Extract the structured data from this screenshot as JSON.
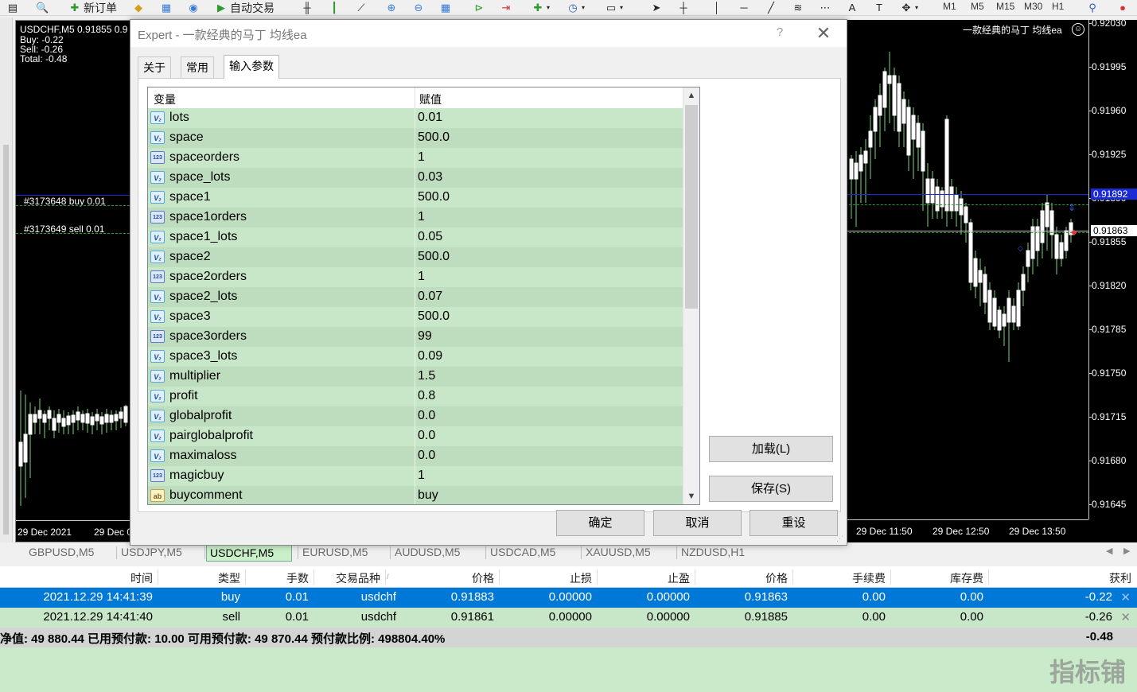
{
  "toolbar": {
    "new_order": "新订单",
    "auto_trading": "自动交易",
    "timeframes": [
      "M1",
      "M5",
      "M15",
      "M30",
      "H1"
    ]
  },
  "chart_left": {
    "symbol_label": "USDCHF,M5  0.91855 0.9",
    "buy": "Buy: -0.22",
    "sell": "Sell: -0.26",
    "total": "Total: -0.48",
    "order_buy": "#3173648 buy 0.01",
    "order_sell": "#3173649 sell 0.01",
    "date1": "29 Dec 2021",
    "date2": "29 Dec 0"
  },
  "chart_right": {
    "ea_label": "一款经典的马丁 均线ea",
    "smile_icon": "smile-icon",
    "prices": [
      "0.92030",
      "0.91995",
      "0.91960",
      "0.91925",
      "0.91890",
      "0.91855",
      "0.91820",
      "0.91785",
      "0.91750",
      "0.91715",
      "0.91680",
      "0.91645"
    ],
    "ask_price": "0.91892",
    "bid_price": "0.91863",
    "times": [
      "29 Dec 11:50",
      "29 Dec 12:50",
      "29 Dec 13:50"
    ]
  },
  "chart_tabs": [
    {
      "label": "GBPUSD,M5",
      "active": false
    },
    {
      "label": "USDJPY,M5",
      "active": false
    },
    {
      "label": "USDCHF,M5",
      "active": true
    },
    {
      "label": "EURUSD,M5",
      "active": false
    },
    {
      "label": "AUDUSD,M5",
      "active": false
    },
    {
      "label": "USDCAD,M5",
      "active": false
    },
    {
      "label": "XAUUSD,M5",
      "active": false
    },
    {
      "label": "NZDUSD,H1",
      "active": false
    }
  ],
  "terminal": {
    "columns": [
      "时间",
      "类型",
      "手数",
      "交易品种",
      "价格",
      "止损",
      "止盈",
      "价格",
      "手续费",
      "库存费",
      "获利"
    ],
    "rows": [
      {
        "time": "2021.12.29 14:41:39",
        "type": "buy",
        "lots": "0.01",
        "symbol": "usdchf",
        "price": "0.91883",
        "sl": "0.00000",
        "tp": "0.00000",
        "cur": "0.91863",
        "commission": "0.00",
        "swap": "0.00",
        "profit": "-0.22",
        "selected": true
      },
      {
        "time": "2021.12.29 14:41:40",
        "type": "sell",
        "lots": "0.01",
        "symbol": "usdchf",
        "price": "0.91861",
        "sl": "0.00000",
        "tp": "0.00000",
        "cur": "0.91885",
        "commission": "0.00",
        "swap": "0.00",
        "profit": "-0.26",
        "selected": false
      }
    ],
    "summary": "净值: 49 880.44  已用预付款: 10.00  可用预付款: 49 870.44  预付款比例: 498804.40%",
    "total_profit": "-0.48",
    "watermark": "指标铺"
  },
  "dialog": {
    "title": "Expert - 一款经典的马丁 均线ea",
    "help": "?",
    "close": "✕",
    "tabs": [
      "关于",
      "常用",
      "输入参数"
    ],
    "active_tab": 2,
    "col_variable": "变量",
    "col_value": "赋值",
    "params": [
      {
        "type": "double",
        "icon": "V₂",
        "name": "lots",
        "value": "0.01"
      },
      {
        "type": "double",
        "icon": "V₂",
        "name": "space",
        "value": "500.0"
      },
      {
        "type": "int",
        "icon": "123",
        "name": "spaceorders",
        "value": "1"
      },
      {
        "type": "double",
        "icon": "V₂",
        "name": "space_lots",
        "value": "0.03"
      },
      {
        "type": "double",
        "icon": "V₂",
        "name": "space1",
        "value": "500.0"
      },
      {
        "type": "int",
        "icon": "123",
        "name": "space1orders",
        "value": "1"
      },
      {
        "type": "double",
        "icon": "V₂",
        "name": "space1_lots",
        "value": "0.05"
      },
      {
        "type": "double",
        "icon": "V₂",
        "name": "space2",
        "value": "500.0"
      },
      {
        "type": "int",
        "icon": "123",
        "name": "space2orders",
        "value": "1"
      },
      {
        "type": "double",
        "icon": "V₂",
        "name": "space2_lots",
        "value": "0.07"
      },
      {
        "type": "double",
        "icon": "V₂",
        "name": "space3",
        "value": "500.0"
      },
      {
        "type": "int",
        "icon": "123",
        "name": "space3orders",
        "value": "99"
      },
      {
        "type": "double",
        "icon": "V₂",
        "name": "space3_lots",
        "value": "0.09"
      },
      {
        "type": "double",
        "icon": "V₂",
        "name": "multiplier",
        "value": "1.5"
      },
      {
        "type": "double",
        "icon": "V₂",
        "name": "profit",
        "value": "0.8"
      },
      {
        "type": "double",
        "icon": "V₂",
        "name": "globalprofit",
        "value": "0.0"
      },
      {
        "type": "double",
        "icon": "V₂",
        "name": "pairglobalprofit",
        "value": "0.0"
      },
      {
        "type": "double",
        "icon": "V₂",
        "name": "maximaloss",
        "value": "0.0"
      },
      {
        "type": "int",
        "icon": "123",
        "name": "magicbuy",
        "value": "1"
      },
      {
        "type": "string",
        "icon": "ab",
        "name": "buycomment",
        "value": "buy"
      }
    ],
    "load_button": "加载(L)",
    "save_button": "保存(S)",
    "ok_button": "确定",
    "cancel_button": "取消",
    "reset_button": "重设"
  }
}
